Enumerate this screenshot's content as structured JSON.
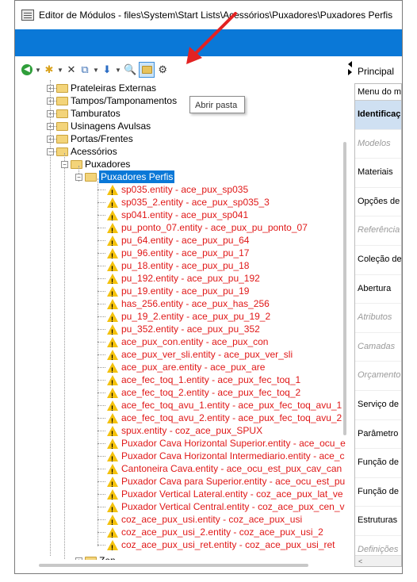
{
  "window": {
    "title": "Editor de Módulos - files\\System\\Start Lists\\Acessórios\\Puxadores\\Puxadores Perfis"
  },
  "toolbar": {
    "icons": [
      "back-icon",
      "new-icon",
      "delete-icon",
      "copy-icon",
      "move-down-icon",
      "search-icon",
      "open-folder-icon",
      "tools-icon"
    ],
    "tooltip": "Abrir pasta"
  },
  "tree": {
    "folders": [
      {
        "label": "Prateleiras Externas"
      },
      {
        "label": "Tampos/Tamponamentos"
      },
      {
        "label": "Tamburatos"
      },
      {
        "label": "Usinagens Avulsas"
      },
      {
        "label": "Portas/Frentes"
      },
      {
        "label": "Acessórios"
      },
      {
        "label": "Puxadores"
      },
      {
        "label": "Puxadores Perfis"
      }
    ],
    "entities": [
      "sp035.entity - ace_pux_sp035",
      "sp035_2.entity - ace_pux_sp035_3",
      "sp041.entity - ace_pux_sp041",
      "pu_ponto_07.entity - ace_pux_pu_ponto_07",
      "pu_64.entity - ace_pux_pu_64",
      "pu_96.entity - ace_pux_pu_17",
      "pu_18.entity - ace_pux_pu_18",
      "pu_192.entity - ace_pux_pu_192",
      "pu_19.entity - ace_pux_pu_19",
      "has_256.entity - ace_pux_has_256",
      "pu_19_2.entity - ace_pux_pu_19_2",
      "pu_352.entity - ace_pux_pu_352",
      "ace_pux_con.entity - ace_pux_con",
      "ace_pux_ver_sli.entity - ace_pux_ver_sli",
      "ace_pux_are.entity - ace_pux_are",
      "ace_fec_toq_1.entity - ace_pux_fec_toq_1",
      "ace_fec_toq_2.entity - ace_pux_fec_toq_2",
      "ace_fec_toq_avu_1.entity - ace_pux_fec_toq_avu_1",
      "ace_fec_toq_avu_2.entity - ace_pux_fec_toq_avu_2",
      "spux.entity - coz_ace_pux_SPUX",
      "Puxador Cava Horizontal Superior.entity - ace_ocu_e",
      "Puxador Cava Horizontal Intermediario.entity - ace_c",
      "Cantoneira Cava.entity - ace_ocu_est_pux_cav_can",
      "Puxador Cava para Superior.entity - ace_ocu_est_pu",
      "Puxador Vertical Lateral.entity - coz_ace_pux_lat_ve",
      "Puxador Vertical Central.entity - coz_ace_pux_cen_v",
      "coz_ace_pux_usi.entity - coz_ace_pux_usi",
      "coz_ace_pux_usi_2.entity - coz_ace_pux_usi_2",
      "coz_ace_pux_usi_ret.entity - coz_ace_pux_usi_ret"
    ],
    "last_folder": "Zen"
  },
  "right_panel": {
    "tab": "Principal",
    "header": "Menu do m",
    "rows": [
      {
        "label": "Identificaç",
        "kind": "selected"
      },
      {
        "label": "Modelos",
        "kind": "category"
      },
      {
        "label": "Materiais",
        "kind": "normal"
      },
      {
        "label": "Opções de",
        "kind": "normal"
      },
      {
        "label": "Referência",
        "kind": "category"
      },
      {
        "label": "Coleção de",
        "kind": "normal"
      },
      {
        "label": "Abertura",
        "kind": "normal"
      },
      {
        "label": "Atributos",
        "kind": "category"
      },
      {
        "label": "Camadas",
        "kind": "category"
      },
      {
        "label": "Orçamento",
        "kind": "category"
      },
      {
        "label": "Serviço de",
        "kind": "normal"
      },
      {
        "label": "Parâmetro",
        "kind": "normal"
      },
      {
        "label": "Função de",
        "kind": "normal"
      },
      {
        "label": "Função de",
        "kind": "normal"
      },
      {
        "label": "Estruturas",
        "kind": "normal"
      },
      {
        "label": "Definições",
        "kind": "category"
      }
    ],
    "scroll_left": "<"
  },
  "colors": {
    "accent_blue": "#0a78d7",
    "entity_red": "#e01818",
    "warning_yellow": "#f4c20d",
    "annotation_red": "#e32222"
  }
}
